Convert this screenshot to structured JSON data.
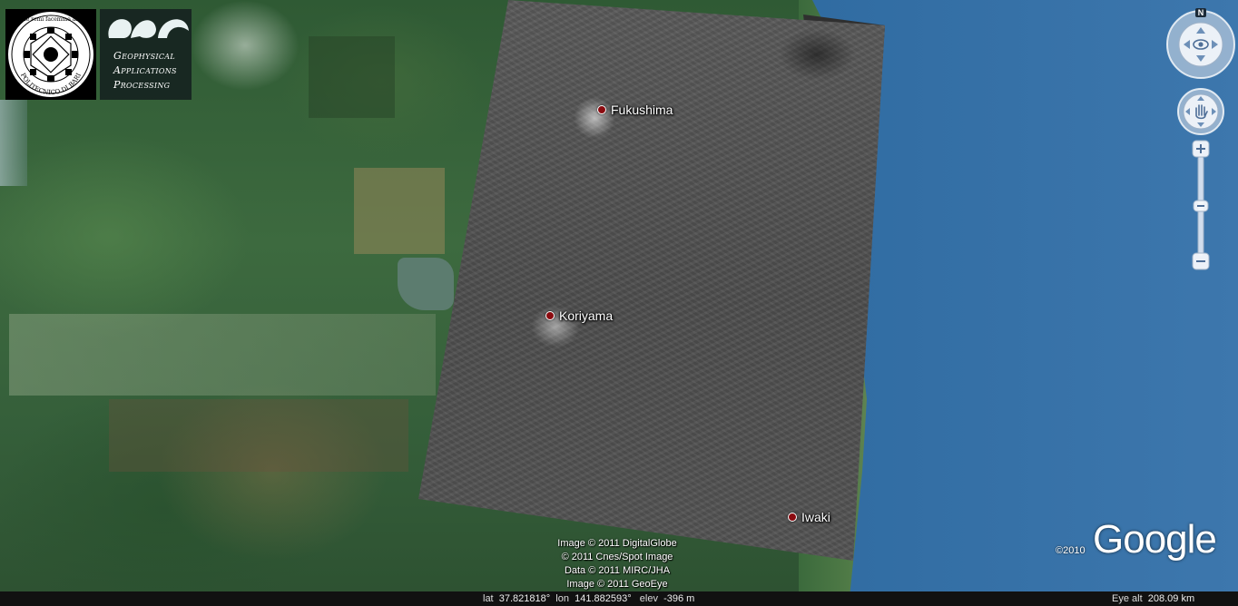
{
  "logos": {
    "poliba": {
      "name": "Politecnico di Bari seal",
      "motto": "de remi facemmo ali",
      "text": "POLITECNICO DI BARI"
    },
    "gap": {
      "name": "Geophysical Applications Processing logo",
      "lines": [
        "Geophysical",
        "Applications",
        "Processing"
      ]
    }
  },
  "places": [
    {
      "name": "Fukushima"
    },
    {
      "name": "Koriyama"
    },
    {
      "name": "Iwaki"
    }
  ],
  "navigation": {
    "north_label": "N"
  },
  "attribution": [
    "Image © 2011 DigitalGlobe",
    "© 2011 Cnes/Spot Image",
    "Data © 2011 MIRC/JHA",
    "Image © 2011 GeoEye"
  ],
  "branding": {
    "copyright_year": "©2010",
    "logo_text": "Google"
  },
  "status_bar": {
    "lat_label": "lat",
    "lat_value": "37.821818°",
    "lon_label": "lon",
    "lon_value": "141.882593°",
    "elev_label": "elev",
    "elev_value": "-396 m",
    "eye_alt_label": "Eye alt",
    "eye_alt_value": "208.09 km"
  },
  "colors": {
    "marker": "#8b0b10",
    "ocean": "#2e6aa0",
    "forest": "#355f3a",
    "sar_overlay": "#555555"
  }
}
